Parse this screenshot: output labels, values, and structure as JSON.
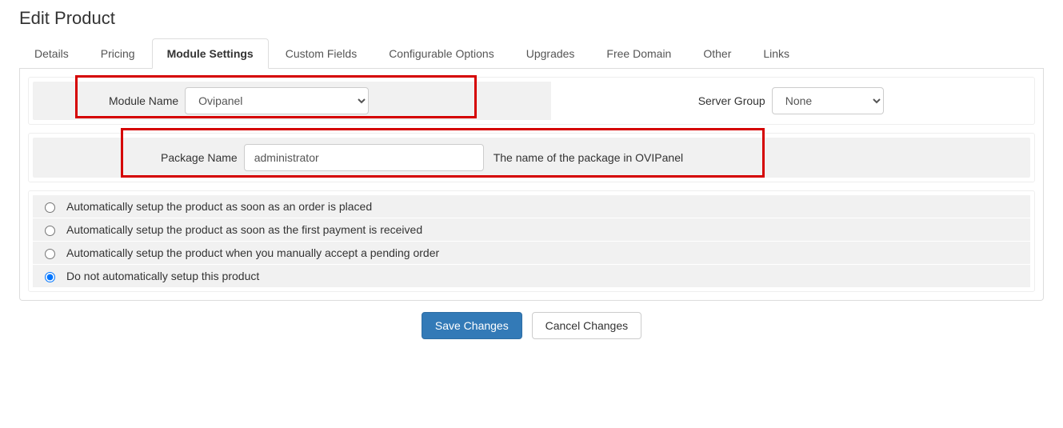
{
  "page": {
    "title": "Edit Product"
  },
  "tabs": [
    {
      "label": "Details"
    },
    {
      "label": "Pricing"
    },
    {
      "label": "Module Settings"
    },
    {
      "label": "Custom Fields"
    },
    {
      "label": "Configurable Options"
    },
    {
      "label": "Upgrades"
    },
    {
      "label": "Free Domain"
    },
    {
      "label": "Other"
    },
    {
      "label": "Links"
    }
  ],
  "module": {
    "name_label": "Module Name",
    "name_value": "Ovipanel",
    "server_group_label": "Server Group",
    "server_group_value": "None"
  },
  "package": {
    "label": "Package Name",
    "value": "administrator",
    "help": "The name of the package in OVIPanel"
  },
  "setup_options": [
    {
      "label": "Automatically setup the product as soon as an order is placed",
      "checked": false
    },
    {
      "label": "Automatically setup the product as soon as the first payment is received",
      "checked": false
    },
    {
      "label": "Automatically setup the product when you manually accept a pending order",
      "checked": false
    },
    {
      "label": "Do not automatically setup this product",
      "checked": true
    }
  ],
  "buttons": {
    "save": "Save Changes",
    "cancel": "Cancel Changes"
  }
}
